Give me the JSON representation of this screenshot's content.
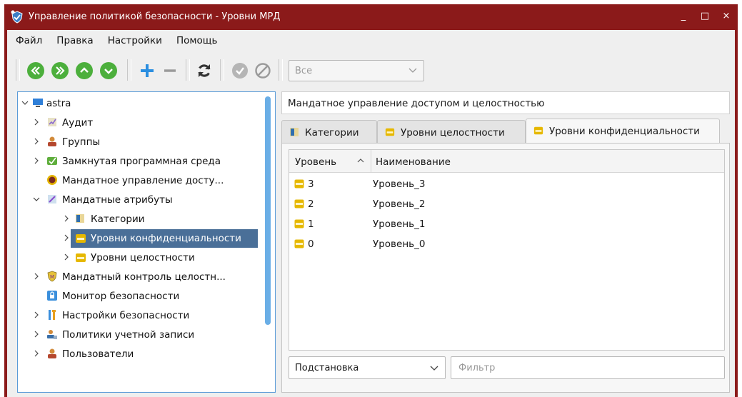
{
  "window": {
    "title": "Управление политикой безопасности - Уровни МРД",
    "controls": {
      "minimize": "_",
      "maximize": "□",
      "close": "×"
    }
  },
  "menu": {
    "items": [
      {
        "label": "Файл"
      },
      {
        "label": "Правка"
      },
      {
        "label": "Настройки"
      },
      {
        "label": "Помощь"
      }
    ]
  },
  "toolbar": {
    "buttons": [
      {
        "name": "first-icon",
        "color": "#4caf3c"
      },
      {
        "name": "last-icon",
        "color": "#4caf3c"
      },
      {
        "name": "up-icon",
        "color": "#4caf3c"
      },
      {
        "name": "down-icon",
        "color": "#4caf3c"
      },
      {
        "name": "add-icon",
        "color": "#2a8ee0"
      },
      {
        "name": "remove-icon",
        "color": "#9a9a9a"
      },
      {
        "name": "refresh-icon",
        "color": "#333333"
      },
      {
        "name": "apply-icon",
        "color": "#b5b5b5"
      },
      {
        "name": "cancel-icon",
        "color": "#9a9a9a"
      }
    ],
    "filter_combo": {
      "value": "Все"
    }
  },
  "tree": {
    "root": {
      "label": "astra"
    },
    "items": [
      {
        "label": "Аудит"
      },
      {
        "label": "Группы"
      },
      {
        "label": "Замкнутая программная среда"
      },
      {
        "label": "Мандатное управление досту..."
      },
      {
        "label": "Мандатные атрибуты"
      },
      {
        "label": "Категории"
      },
      {
        "label": "Уровни конфиденциальности"
      },
      {
        "label": "Уровни целостности"
      },
      {
        "label": "Мандатный контроль целостн..."
      },
      {
        "label": "Монитор безопасности"
      },
      {
        "label": "Настройки безопасности"
      },
      {
        "label": "Политики учетной записи"
      },
      {
        "label": "Пользователи"
      }
    ],
    "selected": "Уровни конфиденциальности"
  },
  "content": {
    "header": "Мандатное управление доступом и целостностью",
    "tabs": [
      {
        "label": "Категории"
      },
      {
        "label": "Уровни целостности"
      },
      {
        "label": "Уровни конфиденциальности"
      }
    ],
    "active_tab": "Уровни конфиденциальности",
    "table": {
      "columns": [
        {
          "label": "Уровень"
        },
        {
          "label": "Наименование"
        }
      ],
      "rows": [
        {
          "level": "3",
          "name": "Уровень_3"
        },
        {
          "level": "2",
          "name": "Уровень_2"
        },
        {
          "level": "1",
          "name": "Уровень_1"
        },
        {
          "level": "0",
          "name": "Уровень_0"
        }
      ]
    },
    "substitution_combo": {
      "value": "Подстановка"
    },
    "filter_input": {
      "placeholder": "Фильтр",
      "value": ""
    }
  },
  "colors": {
    "titlebar": "#8b1a1a",
    "selection": "#4a6f98",
    "focus_border": "#5a9bd8",
    "scrollbar": "#6aaee6"
  }
}
